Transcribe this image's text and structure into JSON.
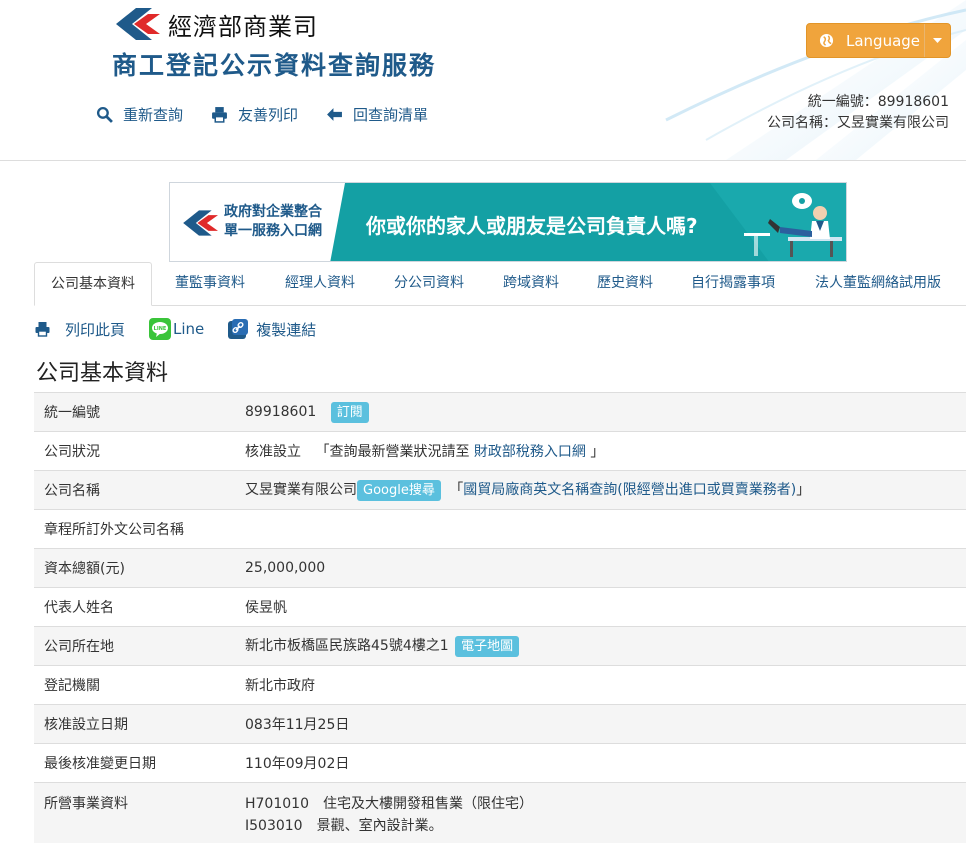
{
  "header": {
    "ministry": "經濟部商業司",
    "service_title": "商工登記公示資料查詢服務",
    "tools": [
      {
        "label": "重新查詢",
        "icon": "search-icon"
      },
      {
        "label": "友善列印",
        "icon": "printer-icon"
      },
      {
        "label": "回查詢清單",
        "icon": "arrow-left-icon"
      }
    ],
    "language_label": "Language",
    "company_id_line": "統一編號：89918601",
    "company_name_line": "公司名稱：又昱實業有限公司"
  },
  "banner": {
    "left_line1": "政府對企業整合",
    "left_line2": "單一服務入口網",
    "question": "你或你的家人或朋友是公司負責人嗎?"
  },
  "tabs": [
    "公司基本資料",
    "董監事資料",
    "經理人資料",
    "分公司資料",
    "跨域資料",
    "歷史資料",
    "自行揭露事項",
    "法人董監網絡試用版"
  ],
  "actions": {
    "print_page": "列印此頁",
    "line": "Line",
    "copy_link": "複製連結"
  },
  "section_title": "公司基本資料",
  "rows": {
    "id_label": "統一編號",
    "id_value": "89918601",
    "subscribe_label": "訂閱",
    "status_label": "公司狀況",
    "status_value": "核准設立",
    "status_note_prefix": "「查詢最新營業狀況請至",
    "status_link": "財政部稅務入口網",
    "status_note_suffix": "」",
    "name_label": "公司名稱",
    "name_value": "又昱實業有限公司",
    "google_search": "Google搜尋",
    "trade_prefix": "「",
    "trade_link": "國貿局廠商英文名稱查詢(限經營出進口或買賣業務者)",
    "trade_suffix": "」",
    "foreign_name_label": "章程所訂外文公司名稱",
    "foreign_name_value": "",
    "capital_label": "資本總額(元)",
    "capital_value": "25,000,000",
    "rep_label": "代表人姓名",
    "rep_value": "侯昱帆",
    "address_label": "公司所在地",
    "address_value": "新北市板橋區民族路45號4樓之1",
    "map_label": "電子地圖",
    "authority_label": "登記機關",
    "authority_value": "新北市政府",
    "setup_date_label": "核准設立日期",
    "setup_date_value": "083年11月25日",
    "change_date_label": "最後核准變更日期",
    "change_date_value": "110年09月02日",
    "business_label": "所營事業資料",
    "business_items": [
      "H701010　住宅及大樓開發租售業（限住宅）",
      "I503010　景觀、室內設計業。"
    ]
  },
  "colors": {
    "brand_blue": "#1f5a8a",
    "logo_red": "#e02a2a",
    "language_orange": "#f0a43c",
    "badge_cyan": "#5bc0de",
    "banner_teal": "#14a0a4"
  }
}
